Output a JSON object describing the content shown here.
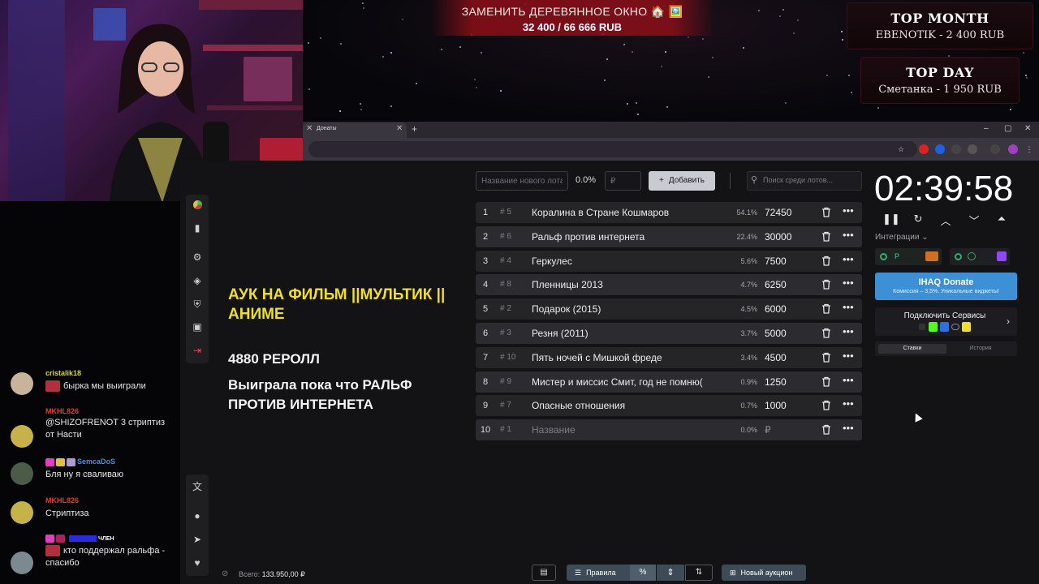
{
  "overlay": {
    "goal_title": "ЗАМЕНИТЬ ДЕРЕВЯННОЕ ОКНО 🏠 🖼️",
    "goal_progress": "32 400 / 66 666 RUB",
    "top_month_title": "TOP MONTH",
    "top_month_value": "EBENOTIK - 2 400 RUB",
    "top_day_title": "TOP DAY",
    "top_day_value": "Сметанка - 1 950 RUB"
  },
  "chat": {
    "messages": [
      {
        "user": "cristalik18",
        "text": "бырка мы выиграли",
        "user_color": "#d6d24a"
      },
      {
        "user": "MKHL826",
        "text": "@SHIZOFRENOT 3 стриптиз от Насти",
        "user_color": "#e0402f"
      },
      {
        "user": "SemcaDoS",
        "text": "Бля ну я сваливаю",
        "user_color": "#4a8fe0"
      },
      {
        "user": "MKHL826",
        "text": "Стриптиза",
        "user_color": "#e0402f"
      },
      {
        "user": "член",
        "text": "кто поддержал ральфа - спасибо",
        "user_color": "#2a2adf"
      }
    ]
  },
  "browser": {
    "tab_title": "Донаты",
    "tab_close": "✕",
    "new_tab": "+",
    "window_controls": [
      "–",
      "▢",
      "✕"
    ]
  },
  "main": {
    "title": "АУК НА ФИЛЬМ ||МУЛЬТИК || АНИМЕ",
    "reroll": "4880 РЕРОЛЛ",
    "winner": "Выиграла пока что РАЛЬФ ПРОТИВ ИНТЕРНЕТА"
  },
  "toolbar": {
    "new_lot_placeholder": "Название нового лота",
    "pct_value": "0.0%",
    "amount_placeholder": "₽",
    "add_label": "Добавить",
    "add_icon": "+",
    "search_placeholder": "Поиск среди лотов..."
  },
  "lots": [
    {
      "index": "1",
      "hash": "# 5",
      "name": "Коралина в Стране Кошмаров",
      "pct": "54.1%",
      "amount": "72450"
    },
    {
      "index": "2",
      "hash": "# 6",
      "name": "Ральф против интернета",
      "pct": "22.4%",
      "amount": "30000"
    },
    {
      "index": "3",
      "hash": "# 4",
      "name": "Геркулес",
      "pct": "5.6%",
      "amount": "7500"
    },
    {
      "index": "4",
      "hash": "# 8",
      "name": "Пленницы 2013",
      "pct": "4.7%",
      "amount": "6250"
    },
    {
      "index": "5",
      "hash": "# 2",
      "name": "Подарок (2015)",
      "pct": "4.5%",
      "amount": "6000"
    },
    {
      "index": "6",
      "hash": "# 3",
      "name": "Резня (2011)",
      "pct": "3.7%",
      "amount": "5000"
    },
    {
      "index": "7",
      "hash": "# 10",
      "name": "Пять ночей с Мишкой фреде",
      "pct": "3.4%",
      "amount": "4500"
    },
    {
      "index": "8",
      "hash": "# 9",
      "name": "Мистер и миссис Смит, год не помню(",
      "pct": "0.9%",
      "amount": "1250"
    },
    {
      "index": "9",
      "hash": "# 7",
      "name": "Опасные отношения",
      "pct": "0.7%",
      "amount": "1000"
    },
    {
      "index": "10",
      "hash": "# 1",
      "name": "Название",
      "pct": "0.0%",
      "amount": "₽"
    }
  ],
  "right_panel": {
    "timer": "02:39:58",
    "integrations_label": "Интеграции ⌄",
    "donate_title": "IHAQ Donate",
    "donate_subtitle": "Комиссия – 3,5%. Уникальные виджеты!",
    "connect_title": "Подключить Сервисы",
    "connect_arrow": "›",
    "tab_bids": "Ставки",
    "tab_history": "История"
  },
  "bottom": {
    "total_label": "Всего:",
    "total_value": "133.950,00 ₽",
    "rules_label": "Правила",
    "pct_label": "%",
    "new_auction_label": "Новый аукцион"
  },
  "icons": {
    "sidebar_top": [
      "pie-chart-icon",
      "bar-chart-icon",
      "gear-icon",
      "layers-icon",
      "shield-icon",
      "media-icon",
      "logout-icon"
    ],
    "sidebar_bottom": [
      "translate-icon",
      "github-icon",
      "telegram-icon",
      "donate-icon"
    ]
  },
  "colors": {
    "accent_yellow": "#f0e020",
    "donate_blue": "#3d8fd6",
    "row_bg": "#252528"
  }
}
